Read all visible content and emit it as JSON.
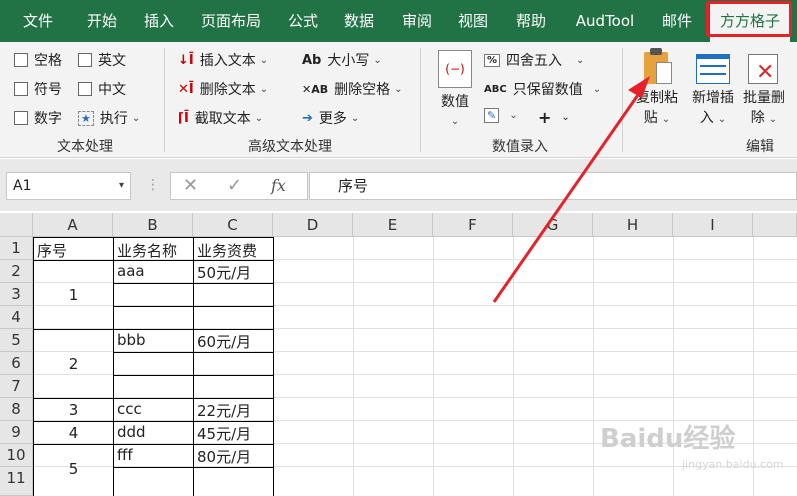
{
  "tabs": [
    {
      "label": "文件"
    },
    {
      "label": "开始"
    },
    {
      "label": "插入"
    },
    {
      "label": "页面布局"
    },
    {
      "label": "公式"
    },
    {
      "label": "数据"
    },
    {
      "label": "审阅"
    },
    {
      "label": "视图"
    },
    {
      "label": "帮助"
    },
    {
      "label": "AudTool"
    },
    {
      "label": "邮件"
    },
    {
      "label": "方方格子"
    }
  ],
  "ribbon": {
    "text_group": {
      "checkboxes": [
        "空格",
        "英文",
        "符号",
        "中文",
        "数字"
      ],
      "execute_label": "执行",
      "group_label": "文本处理"
    },
    "advanced_text": {
      "insert_text": "插入文本",
      "delete_text": "删除文本",
      "cut_text": "截取文本",
      "case_label": "大小写",
      "delete_spaces": "删除空格",
      "more_label": "更多",
      "group_label": "高级文本处理"
    },
    "number_entry": {
      "number_label": "数值",
      "round_label": "四舍五入",
      "keep_values": "只保留数值",
      "plus_label": "+",
      "group_label": "数值录入"
    },
    "edit_group": {
      "copy_paste_line1": "复制粘",
      "copy_paste_line2": "贴",
      "add_insert_line1": "新增插",
      "add_insert_line2": "入",
      "batch_delete_line1": "批量删",
      "batch_delete_line2": "除",
      "group_label": "编辑"
    }
  },
  "formula_bar": {
    "name_box": "A1",
    "fx_label": "fx",
    "formula": "序号"
  },
  "sheet": {
    "columns": [
      "A",
      "B",
      "C",
      "D",
      "E",
      "F",
      "G",
      "H",
      "I"
    ],
    "rows": [
      "1",
      "2",
      "3",
      "4",
      "5",
      "6",
      "7",
      "8",
      "9",
      "10",
      "11"
    ],
    "header": {
      "a": "序号",
      "b": "业务名称",
      "c": "业务资费"
    },
    "r2": {
      "b": "aaa",
      "c": "50元/月"
    },
    "merged1": "1",
    "r5": {
      "b": "bbb",
      "c": "60元/月"
    },
    "merged2": "2",
    "r8": {
      "a": "3",
      "b": "ccc",
      "c": "22元/月"
    },
    "r9": {
      "a": "4",
      "b": "ddd",
      "c": "45元/月"
    },
    "r10": {
      "b": "fff",
      "c": "80元/月"
    },
    "merged5": "5"
  },
  "watermark": {
    "main": "Baidu经验",
    "sub": "jingyan.baidu.com"
  },
  "colors": {
    "excel_green": "#217346",
    "highlight_red": "#e5222a"
  }
}
